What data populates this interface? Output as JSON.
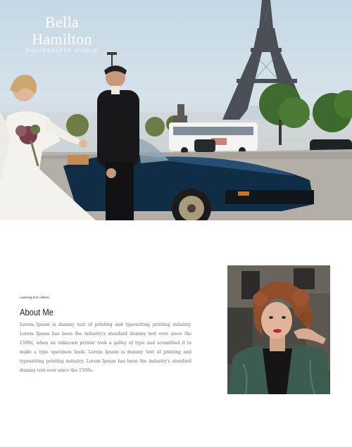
{
  "brand": {
    "name_line1": "Bella",
    "name_line2": "Hamilton",
    "tagline": "PHOTOGRAPHY STUDIO"
  },
  "hero": {
    "image_alt": "hero-photo"
  },
  "about": {
    "eyebrow": "Learning from others.",
    "title": "About Me",
    "body": "Lorem Ipsum is dummy text of printing and typesetting printing industry. Lorem Ipsum has been the industry's standard dummy text ever since the 1500s, when an unknown printer took a galley of type and scrambled it to make a type specimen book. Lorem Ipsum is dummy text of printing and typesetting printing industry. Lorem Ipsum has been the industry's standard dummy text ever since the 1500s."
  },
  "colors": {
    "logo_text": "#ffffff",
    "heading": "#1e1e1e",
    "body_text": "#6a6a6a"
  }
}
